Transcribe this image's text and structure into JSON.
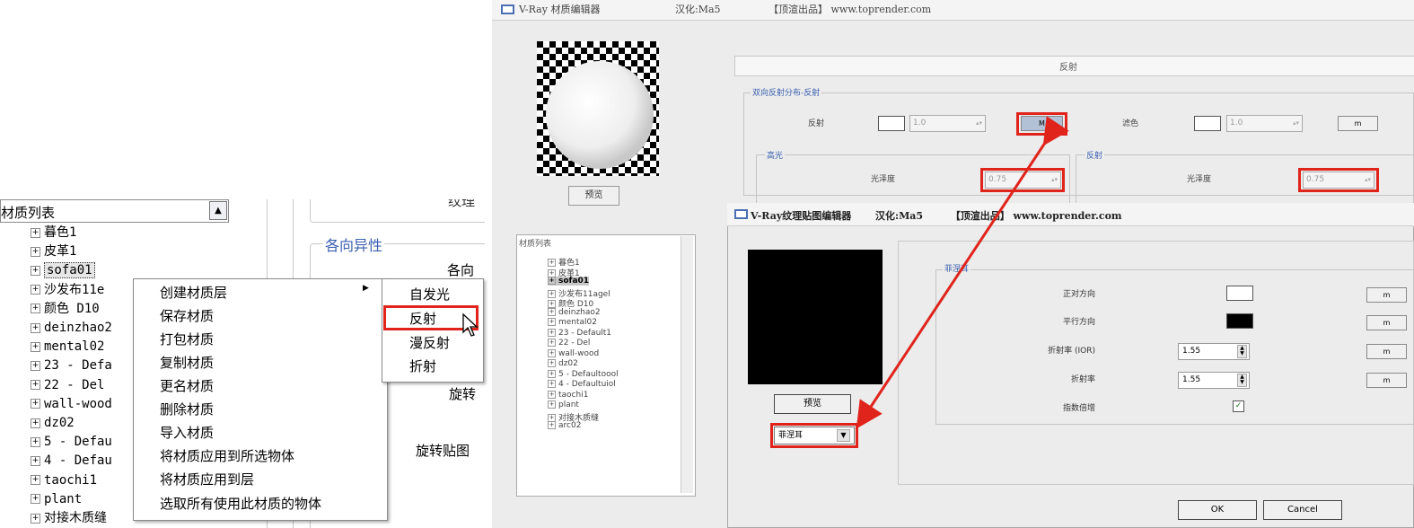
{
  "left_panel": {
    "list_title": "材质列表",
    "tree_items": [
      {
        "label": "暮色1"
      },
      {
        "label": "皮革1"
      },
      {
        "label": "sofa01",
        "selected": true
      },
      {
        "label": "沙发布11e"
      },
      {
        "label": "颜色 D10"
      },
      {
        "label": "deinzhao2"
      },
      {
        "label": "mental02"
      },
      {
        "label": "23 - Defa"
      },
      {
        "label": "22 - Del"
      },
      {
        "label": "wall-wood"
      },
      {
        "label": "dz02"
      },
      {
        "label": "5 - Defau"
      },
      {
        "label": "4 - Defau"
      },
      {
        "label": "taochi1"
      },
      {
        "label": "plant"
      },
      {
        "label": "对接木质缝"
      }
    ],
    "props": {
      "texture_label": "纹理",
      "aniso_title": "各向异性",
      "aniso_item": "各向",
      "rotate_label": "旋转",
      "rotate_map_label": "旋转贴图"
    },
    "context_menu": {
      "items": [
        {
          "label": "创建材质层",
          "has_submenu": true
        },
        {
          "label": "保存材质"
        },
        {
          "label": "打包材质"
        },
        {
          "label": "复制材质"
        },
        {
          "label": "更名材质"
        },
        {
          "label": "删除材质"
        },
        {
          "label": "导入材质"
        },
        {
          "label": "将材质应用到所选物体"
        },
        {
          "label": "将材质应用到层"
        },
        {
          "label": "选取所有使用此材质的物体"
        }
      ]
    },
    "sub_menu": {
      "items": [
        {
          "label": "自发光"
        },
        {
          "label": "反射",
          "highlighted": true
        },
        {
          "label": "漫反射"
        },
        {
          "label": "折射"
        }
      ]
    }
  },
  "material_editor": {
    "title": "V-Ray 材质编辑器",
    "localized_by": "汉化:Ma5",
    "credit": "【顶渲出品】 www.toprender.com",
    "preview_button": "预览",
    "list_title": "材质列表",
    "list_items": [
      "暮色1",
      "皮革1",
      "sofa01",
      "沙发布11agel",
      "颜色 D10",
      "deinzhao2",
      "mental02",
      "23 - Default1",
      "22 - Del",
      "wall-wood",
      "dz02",
      "5 - Defaultoool",
      "4 - Defaultuiol",
      "taochi1",
      "plant",
      "对接木质缝",
      "arc02"
    ],
    "selected_item": "sofa01",
    "section_header": "反射",
    "brdf_title": "双向反射分布-反射",
    "reflection_label": "反射",
    "reflection_value": "1.0",
    "map_button_hl": "M",
    "filter_label": "滤色",
    "filter_value": "1.0",
    "map_button": "m",
    "highlight_title": "高光",
    "highlight_gloss_label": "光泽度",
    "highlight_gloss_value": "0.75",
    "refl_title": "反射",
    "refl_gloss_label": "光泽度",
    "refl_gloss_value": "0.75"
  },
  "texture_editor": {
    "title": "V-Ray纹理贴图编辑器",
    "localized_by": "汉化:Ma5",
    "credit": "【顶渲出品】 www.toprender.com",
    "preview_button": "预览",
    "type_select": "菲涅耳",
    "group_title": "菲涅耳",
    "rows": [
      {
        "label": "正对方向",
        "type": "swatch",
        "color": "#ffffff",
        "button": "m"
      },
      {
        "label": "平行方向",
        "type": "swatch",
        "color": "#000000",
        "button": "m"
      },
      {
        "label": "折射率 (IOR)",
        "type": "spin",
        "value": "1.55",
        "button": "m"
      },
      {
        "label": "折射率",
        "type": "spin",
        "value": "1.55",
        "button": "m"
      },
      {
        "label": "指数倍增",
        "type": "checkbox",
        "checked": true
      }
    ],
    "ok_button": "OK",
    "cancel_button": "Cancel"
  },
  "colors": {
    "highlight_red": "#e0241c",
    "group_title_blue": "#3a5fb0"
  }
}
